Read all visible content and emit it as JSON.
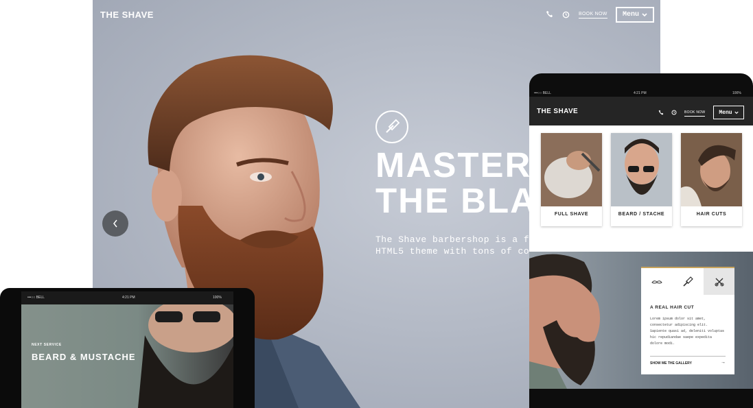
{
  "hero": {
    "logo": "THE SHAVE",
    "book_now": "BOOK NOW",
    "menu_label": "Menu",
    "title_line1": "MASTERS",
    "title_line2": "THE BLA",
    "desc_line1": "The Shave barbershop is a f",
    "desc_line2": "HTML5 theme with tons of co"
  },
  "tablet": {
    "status_left": "•••○○ BELL",
    "status_time": "4:21 PM",
    "status_battery": "100%",
    "logo": "THE SHAVE",
    "book_now": "BOOK NOW",
    "menu_label": "Menu",
    "cards": [
      {
        "label": "FULL SHAVE"
      },
      {
        "label": "BEARD / STACHE"
      },
      {
        "label": "HAIR CUTS"
      }
    ],
    "panel": {
      "title": "A REAL HAIR CUT",
      "body": "Lorem ipsum dolor sit amet, consectetur adipiscing elit. Sapiente quasi ad, deleniti voluptas hic repudiandae saepe expedita dolore modi.",
      "link": "SHOW ME THE GALLERY",
      "link_arrow": "→"
    }
  },
  "phone": {
    "status_left": "•••○○ BELL",
    "status_time": "4:21 PM",
    "status_battery": "100%",
    "next_label": "NEXT SERVICE",
    "next_title": "BEARD & MUSTACHE"
  },
  "colors": {
    "hero_bg": "#b4bac6",
    "tablet_nav": "#252525",
    "accent_gold": "#c9a45c"
  }
}
